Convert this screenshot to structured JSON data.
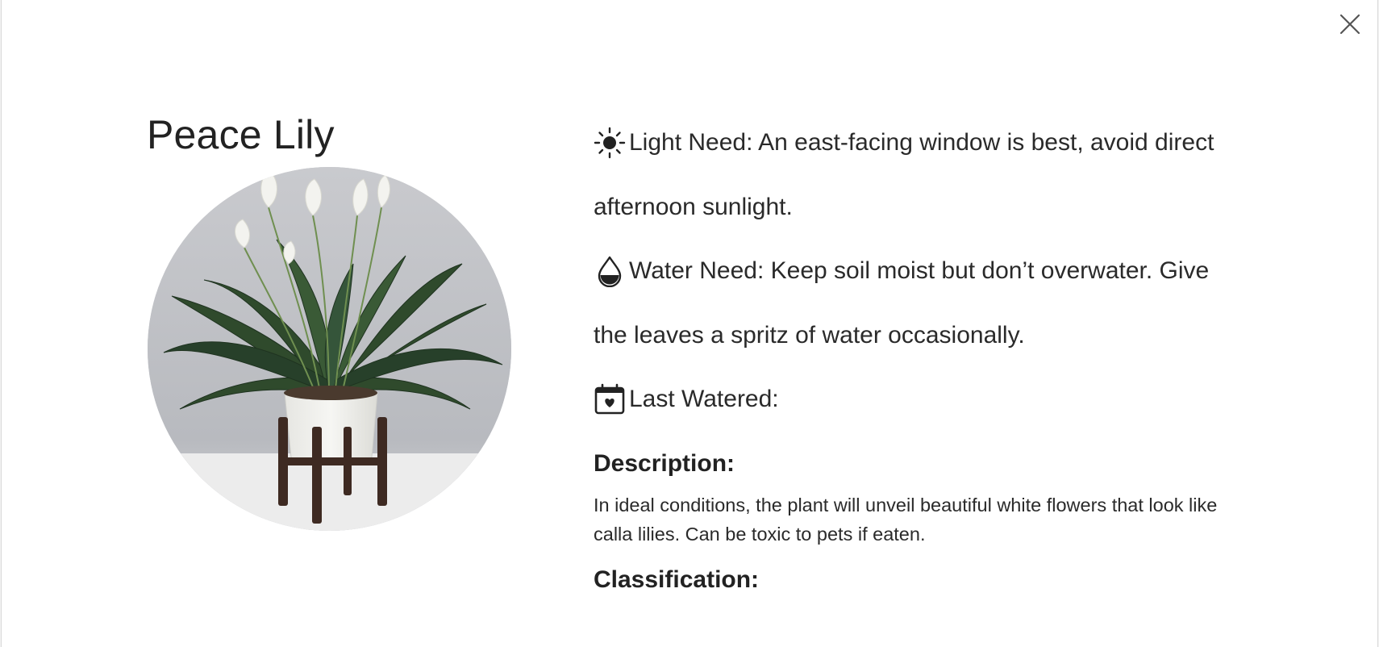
{
  "modal": {
    "close_label": "close",
    "plant": {
      "name": "Peace Lily",
      "image_alt": "Peace Lily plant in white pot on wooden stand"
    },
    "light": {
      "icon": "sun-icon",
      "line1": "Light Need: An east-facing window is best, avoid direct",
      "line2": "afternoon sunlight."
    },
    "water": {
      "icon": "water-drop-icon",
      "line1": "Water Need: Keep soil moist but don’t overwater. Give",
      "line2": "the leaves a spritz of water occasionally."
    },
    "last_watered": {
      "icon": "calendar-heart-icon",
      "label": "Last Watered:"
    },
    "description": {
      "heading": "Description:",
      "text": "In ideal conditions, the plant will unveil beautiful white flowers that look like calla lilies. Can be toxic to pets if eaten."
    },
    "classification": {
      "heading": "Classification:"
    }
  }
}
